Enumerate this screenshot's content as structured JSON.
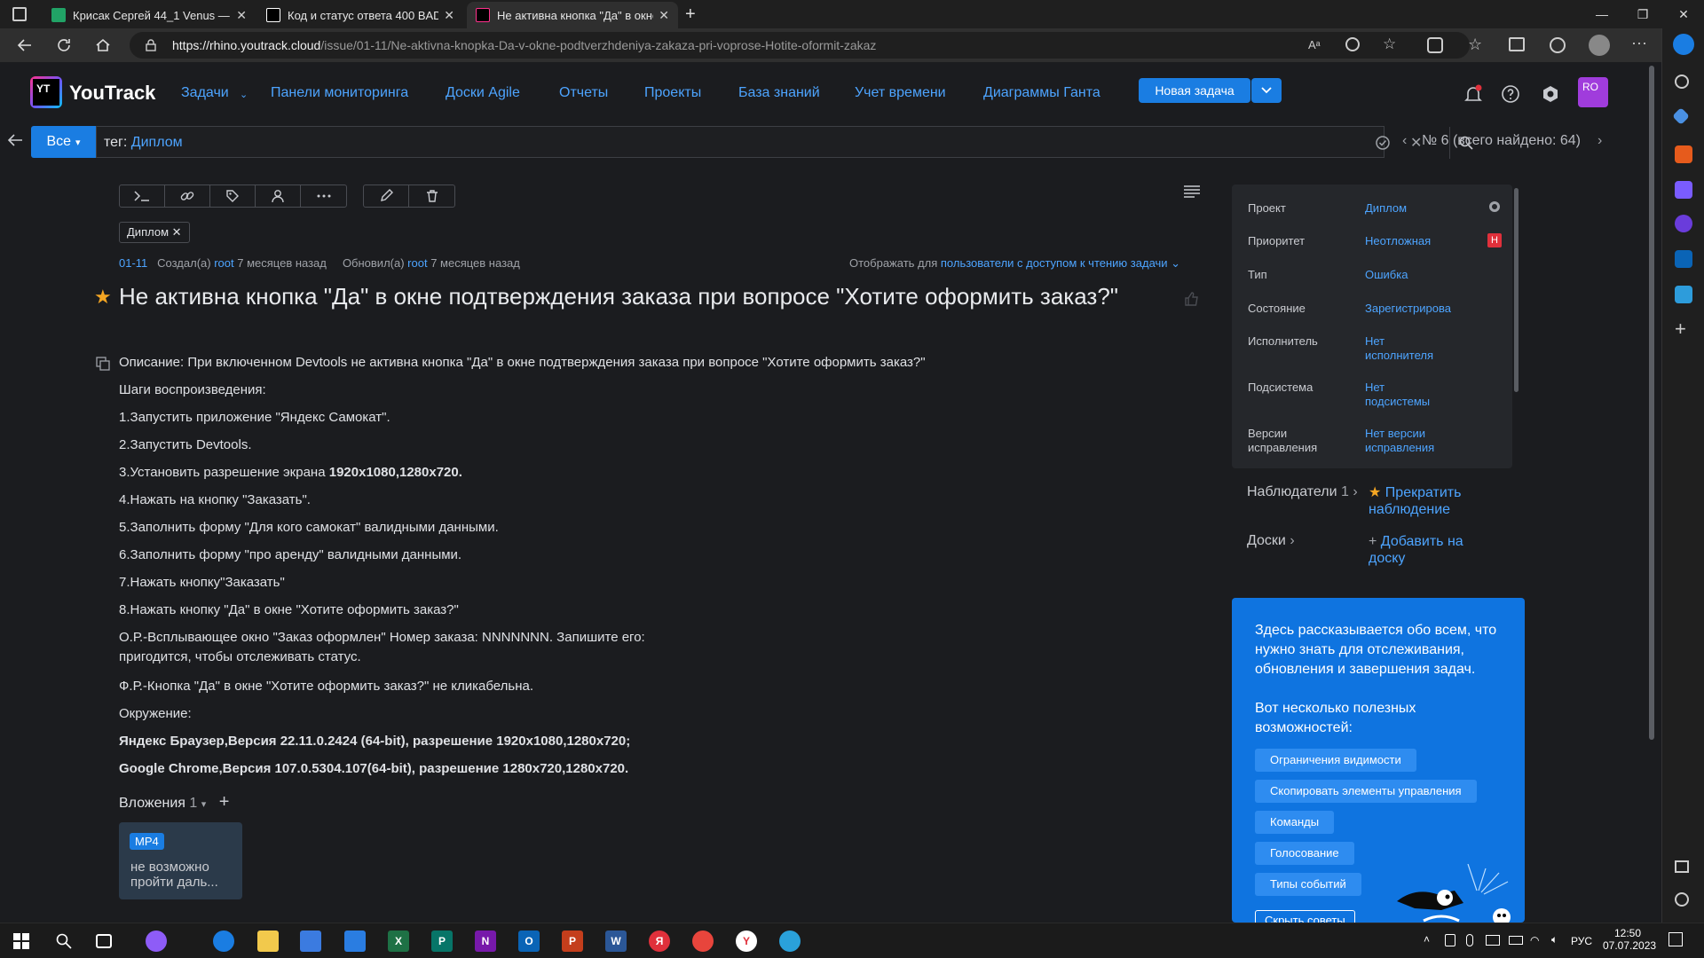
{
  "browser": {
    "tabs": [
      {
        "title": "Крисак Сергей 44_1 Venus — да",
        "active": false
      },
      {
        "title": "Код и статус ответа 400 BAD RE",
        "active": false
      },
      {
        "title": "Не активна кнопка \"Да\" в окне",
        "active": true
      }
    ],
    "url_host": "https://rhino.youtrack.cloud",
    "url_path": "/issue/01-11/Ne-aktivna-knopka-Da-v-okne-podtverzhdeniya-zakaza-pri-voprose-Hotite-oformit-zakaz"
  },
  "header": {
    "brand": "YouTrack",
    "nav": [
      "Задачи",
      "Панели мониторинга",
      "Доски Agile",
      "Отчеты",
      "Проекты",
      "База знаний",
      "Учет времени",
      "Диаграммы Ганта"
    ],
    "new_task": "Новая задача",
    "avatar": "RO"
  },
  "search": {
    "scope": "Все",
    "query_prefix": "тег:",
    "query_value": "Диплом",
    "counter": "№ 6 (всего найдено: 64)"
  },
  "issue": {
    "tag": "Диплом",
    "id": "01-11",
    "created_label": "Создал(а)",
    "created_by": "root",
    "created_when": "7 месяцев назад",
    "updated_label": "Обновил(а)",
    "updated_by": "root",
    "updated_when": "7 месяцев назад",
    "visibility_label": "Отображать для",
    "visibility_value": "пользователи с доступом к чтению задачи",
    "title": "Не активна кнопка \"Да\" в окне подтверждения заказа при вопросе \"Хотите оформить заказ?\"",
    "description": [
      {
        "text": "Описание: При включенном Devtools не активна кнопка \"Да\" в окне подтверждения заказа при вопросе \"Хотите оформить заказ?\"",
        "bold": false
      },
      {
        "text": "Шаги воспроизведения:",
        "bold": false
      },
      {
        "text": "1.Запустить приложение \"Яндекс Самокат\".",
        "bold": false
      },
      {
        "text": "2.Запустить Devtools.",
        "bold": false
      },
      {
        "text": "3.Установить разрешение экрана ",
        "bold_tail": "1920x1080,1280x720.",
        "bold": false
      },
      {
        "text": "4.Нажать на кнопку \"Заказать\".",
        "bold": false
      },
      {
        "text": "5.Заполнить форму \"Для кого самокат\" валидными данными.",
        "bold": false
      },
      {
        "text": "6.Заполнить форму \"про аренду\" валидными данными.",
        "bold": false
      },
      {
        "text": "7.Нажать кнопку\"Заказать\"",
        "bold": false
      },
      {
        "text": "8.Нажать кнопку \"Да\" в окне \"Хотите оформить заказ?\"",
        "bold": false
      },
      {
        "text": "О.Р.-Всплывающее окно \"Заказ оформлен\" Номер заказа: NNNNNNN.  Запишите его:\nпригодится, чтобы отслеживать статус.",
        "bold": false
      },
      {
        "text": "Ф.Р.-Кнопка \"Да\" в окне \"Хотите оформить заказ?\" не кликабельна.",
        "bold": false
      },
      {
        "text": "Окружение:",
        "bold": false
      },
      {
        "text": "Яндекс Браузер,Версия 22.11.0.2424 (64-bit), разрешение 1920x1080,1280x720;",
        "bold": true
      },
      {
        "text": "Google Chrome,Версия 107.0.5304.107(64-bit), разрешение 1280x720,1280x720.",
        "bold": true
      }
    ],
    "attachments_label": "Вложения",
    "attachments_count": "1",
    "attachment": {
      "type": "MP4",
      "name": "не возможно пройти даль..."
    }
  },
  "fields": [
    {
      "label": "Проект",
      "value": "Диплом"
    },
    {
      "label": "Приоритет",
      "value": "Неотложная",
      "badge": "Н"
    },
    {
      "label": "Тип",
      "value": "Ошибка"
    },
    {
      "label": "Состояние",
      "value": "Зарегистрирова"
    },
    {
      "label": "Исполнитель",
      "value": "Нет исполнителя"
    },
    {
      "label": "Подсистема",
      "value": "Нет подсистемы"
    },
    {
      "label": "Версии исправления",
      "value": "Нет версии исправления"
    }
  ],
  "watchers": {
    "label": "Наблюдатели",
    "count": "1",
    "action": "Прекратить наблюдение"
  },
  "boards": {
    "label": "Доски",
    "action": "Добавить на доску"
  },
  "promo": {
    "intro": "Здесь рассказывается обо всем, что нужно знать для отслеживания, обновления и завершения задач.",
    "features_title": "Вот несколько полезных возможностей:",
    "features": [
      "Ограничения видимости",
      "Скопировать элементы управления",
      "Команды",
      "Голосование",
      "Типы событий"
    ],
    "hide": "Скрыть советы"
  },
  "taskbar": {
    "lang": "РУС",
    "time": "12:50",
    "date": "07.07.2023"
  },
  "colors": {
    "accent": "#1a7de2",
    "link": "#4da4ff",
    "bg": "#1b1c1f",
    "priority": "#e0303b"
  }
}
